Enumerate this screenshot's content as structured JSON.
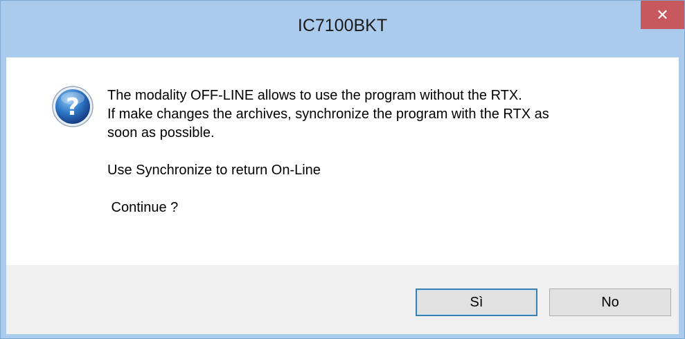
{
  "window": {
    "title": "IC7100BKT",
    "close_glyph": "✕"
  },
  "dialog": {
    "icon": "question-icon",
    "message_lines": [
      "The modality OFF-LINE allows to use the program without the RTX.",
      "If make changes the archives, synchronize the program with the RTX as",
      "soon as possible.",
      "",
      "Use Synchronize to return On-Line",
      "",
      " Continue ?"
    ]
  },
  "buttons": {
    "yes_label": "Sì",
    "no_label": "No"
  },
  "colors": {
    "frame": "#aacbeb",
    "close_button": "#c6585e",
    "button_bar": "#f0f0f0",
    "default_button_border": "#3c7fb1"
  }
}
